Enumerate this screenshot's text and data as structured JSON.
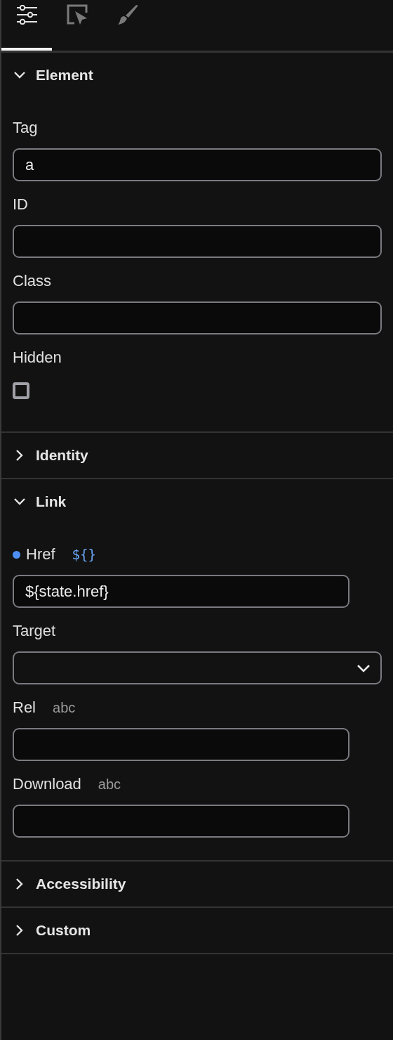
{
  "tabs": [
    {
      "kind": "sliders",
      "selected": true
    },
    {
      "kind": "cursor",
      "selected": false
    },
    {
      "kind": "brush",
      "selected": false
    }
  ],
  "sections": [
    {
      "title": "Element",
      "expanded": true,
      "fields": [
        {
          "kind": "text",
          "label": "Tag",
          "value": "a"
        },
        {
          "kind": "text",
          "label": "ID"
        },
        {
          "kind": "text",
          "label": "Class"
        },
        {
          "kind": "checkbox",
          "label": "Hidden",
          "checked": false
        }
      ]
    },
    {
      "title": "Identity",
      "expanded": false
    },
    {
      "title": "Link",
      "expanded": true,
      "fields": [
        {
          "kind": "text",
          "label": "Href",
          "bound": true,
          "hint": {
            "text": "${}",
            "kind": "binding"
          },
          "value": "${state.href}"
        },
        {
          "kind": "select",
          "label": "Target"
        },
        {
          "kind": "text",
          "label": "Rel",
          "hint": {
            "text": "abc",
            "kind": "plain"
          }
        },
        {
          "kind": "text",
          "label": "Download",
          "hint": {
            "text": "abc",
            "kind": "plain"
          }
        }
      ]
    },
    {
      "title": "Accessibility",
      "expanded": false
    },
    {
      "title": "Custom",
      "expanded": false
    }
  ]
}
